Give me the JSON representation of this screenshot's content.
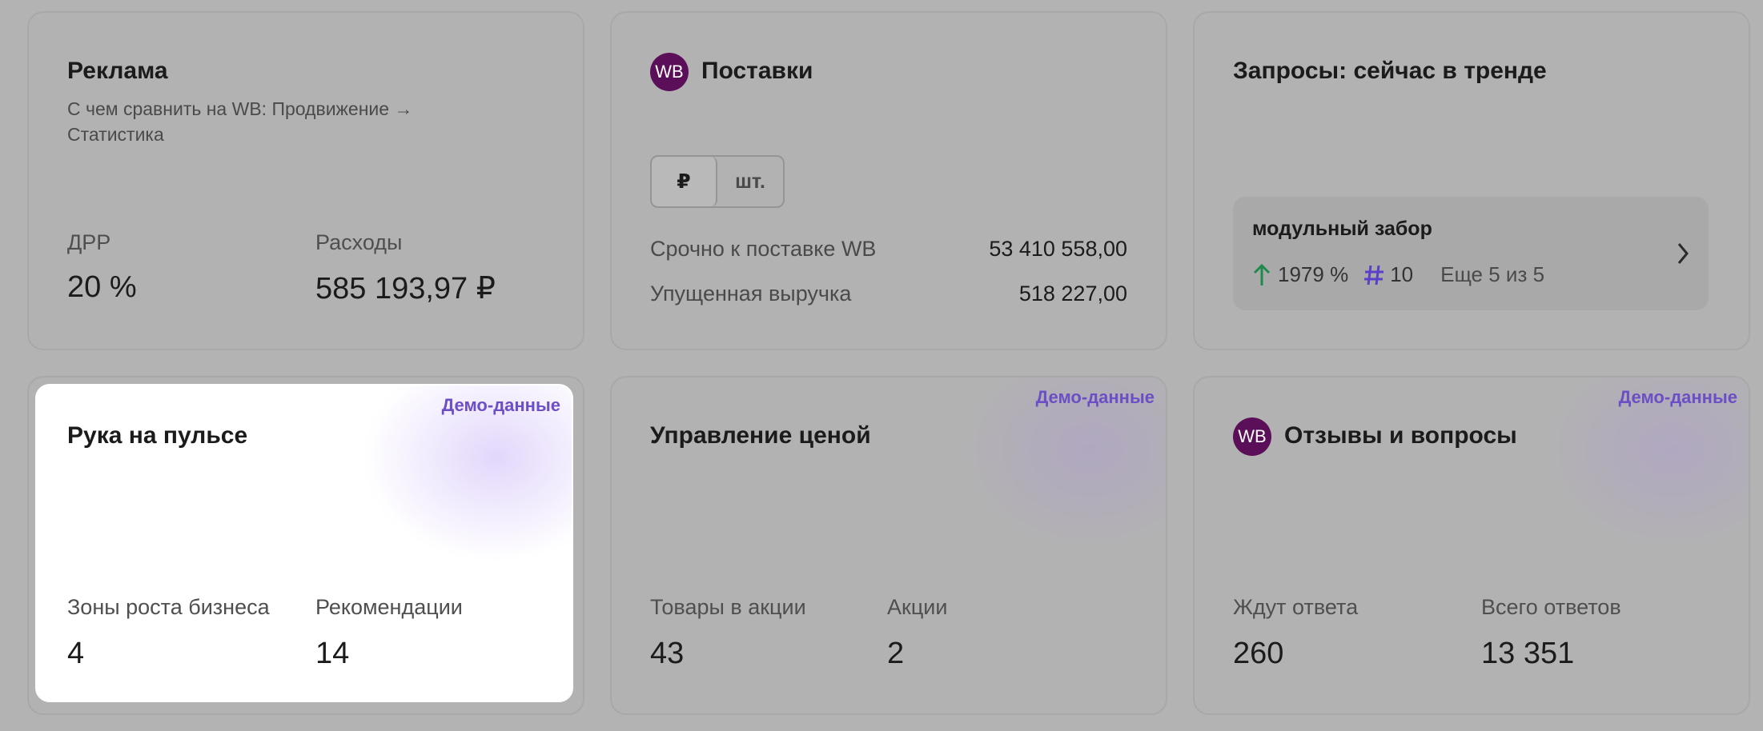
{
  "cards": {
    "ads": {
      "title": "Реклама",
      "subtitle": "С чем сравнить на WB: Продвижение → Статистика",
      "metrics": [
        {
          "label": "ДРР",
          "value": "20 %"
        },
        {
          "label": "Расходы",
          "value": "585 193,97 ₽"
        }
      ]
    },
    "supplies": {
      "badge": "WB",
      "title": "Поставки",
      "toggle": {
        "active": "₽",
        "other": "шт."
      },
      "rows": [
        {
          "label": "Срочно к поставке WB",
          "value": "53 410 558,00"
        },
        {
          "label": "Упущенная выручка",
          "value": "518 227,00"
        }
      ]
    },
    "trends": {
      "title": "Запросы: сейчас в тренде",
      "query": "модульный забор",
      "growth": "1979 %",
      "rank": "10",
      "more": "Еще 5 из 5"
    },
    "pulse": {
      "demo": "Демо-данные",
      "title": "Рука на пульсе",
      "metrics": [
        {
          "label": "Зоны роста бизнеса",
          "value": "4"
        },
        {
          "label": "Рекомендации",
          "value": "14"
        }
      ]
    },
    "price": {
      "demo": "Демо-данные",
      "title": "Управление ценой",
      "metrics": [
        {
          "label": "Товары в акции",
          "value": "43"
        },
        {
          "label": "Акции",
          "value": "2"
        }
      ]
    },
    "reviews": {
      "demo": "Демо-данные",
      "badge": "WB",
      "title": "Отзывы и вопросы",
      "metrics": [
        {
          "label": "Ждут ответа",
          "value": "260"
        },
        {
          "label": "Всего ответов",
          "value": "13 351"
        }
      ]
    }
  },
  "colors": {
    "overlay": "#b3b3b3",
    "demo_label": "#6c4fc4",
    "wb_badge": "#5c0f59",
    "growth_arrow": "#1f8a4c",
    "rank_hash": "#5b3fc8"
  },
  "icons": [
    "arrow-up-icon",
    "hash-icon",
    "chevron-right-icon"
  ]
}
